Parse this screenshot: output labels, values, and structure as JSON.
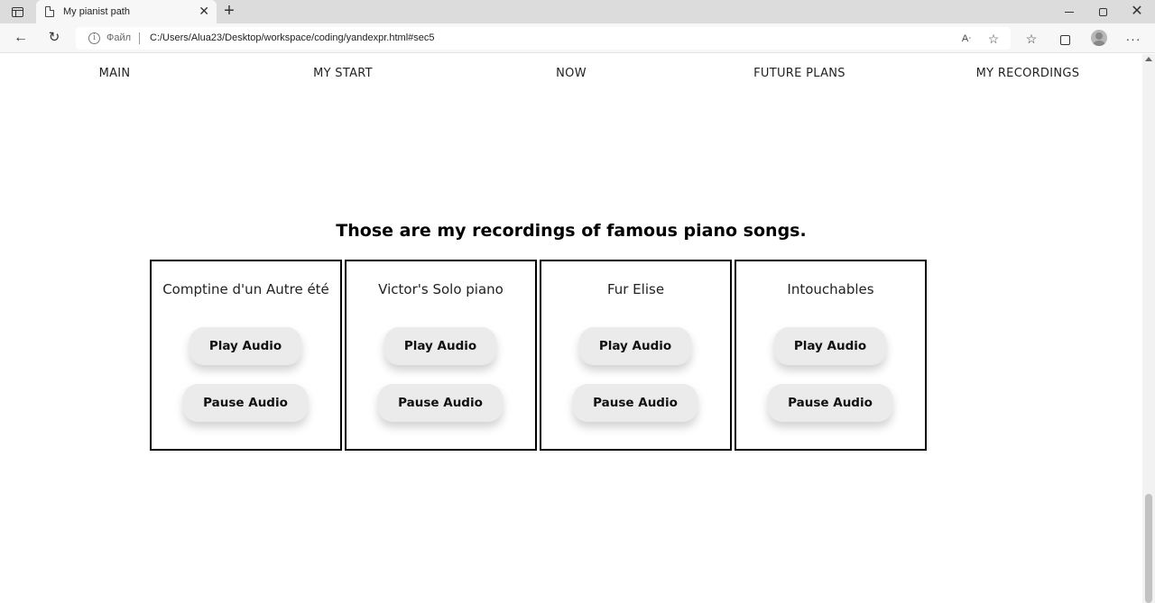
{
  "browser": {
    "tab_title": "My pianist path",
    "file_label": "Файл",
    "url": "C:/Users/Alua23/Desktop/workspace/coding/yandexpr.html#sec5"
  },
  "nav": {
    "items": [
      "MAIN",
      "MY START",
      "NOW",
      "FUTURE PLANS",
      "MY RECORDINGS"
    ]
  },
  "section": {
    "heading": "Those are my recordings of famous piano songs.",
    "recordings": [
      {
        "title": "Comptine d'un Autre été",
        "play_label": "Play Audio",
        "pause_label": "Pause Audio"
      },
      {
        "title": "Victor's Solo piano",
        "play_label": "Play Audio",
        "pause_label": "Pause Audio"
      },
      {
        "title": "Fur Elise",
        "play_label": "Play Audio",
        "pause_label": "Pause Audio"
      },
      {
        "title": "Intouchables",
        "play_label": "Play Audio",
        "pause_label": "Pause Audio"
      }
    ]
  }
}
